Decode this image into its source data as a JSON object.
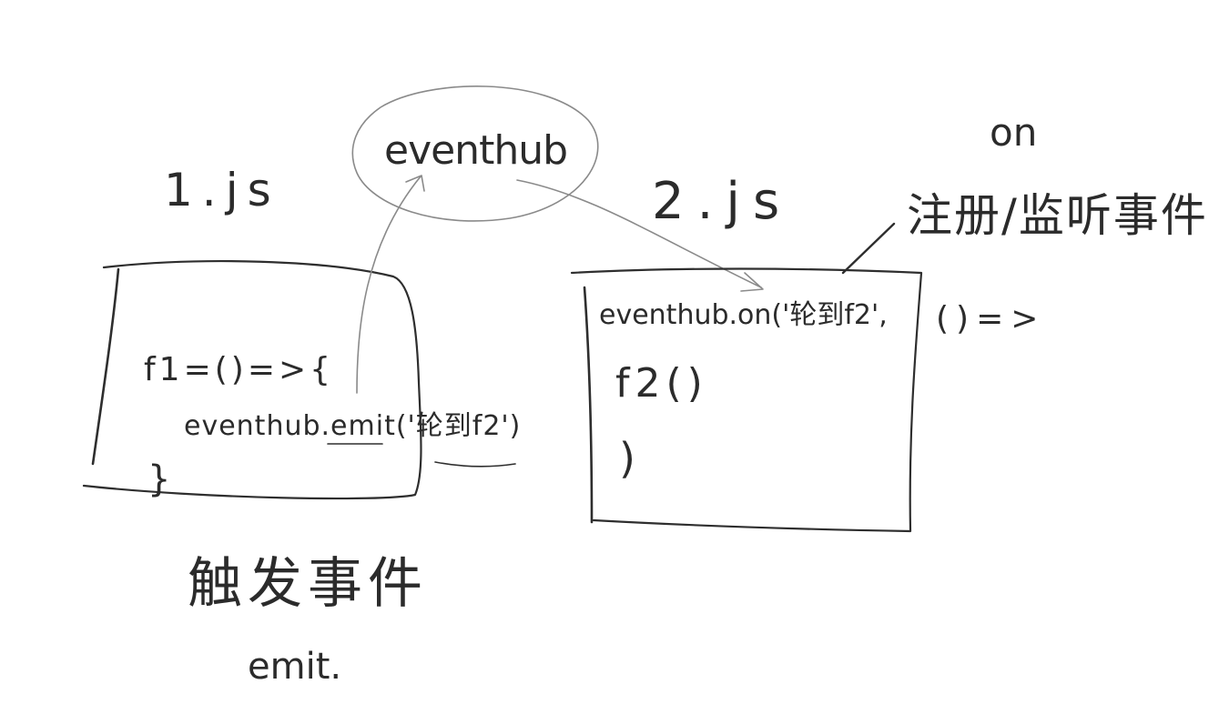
{
  "hub": {
    "label": "eventhub"
  },
  "file_one": {
    "label": "1.js",
    "code": {
      "line1": "f1=()=>{",
      "line2": "eventhub.emit('轮到f2')",
      "line3": "}"
    },
    "caption": "触发事件",
    "caption_sub": "emit."
  },
  "file_two": {
    "label": "2.js",
    "code": {
      "line1": "eventhub.on('轮到f2',",
      "line1_tail": "()=>",
      "line2": "f2()",
      "line3": ")"
    },
    "caption_sub": "on",
    "caption": "注册/监听事件"
  },
  "colors": {
    "ink": "#2b2b2b",
    "pencil": "#8a8a8a",
    "paper": "#ffffff"
  }
}
